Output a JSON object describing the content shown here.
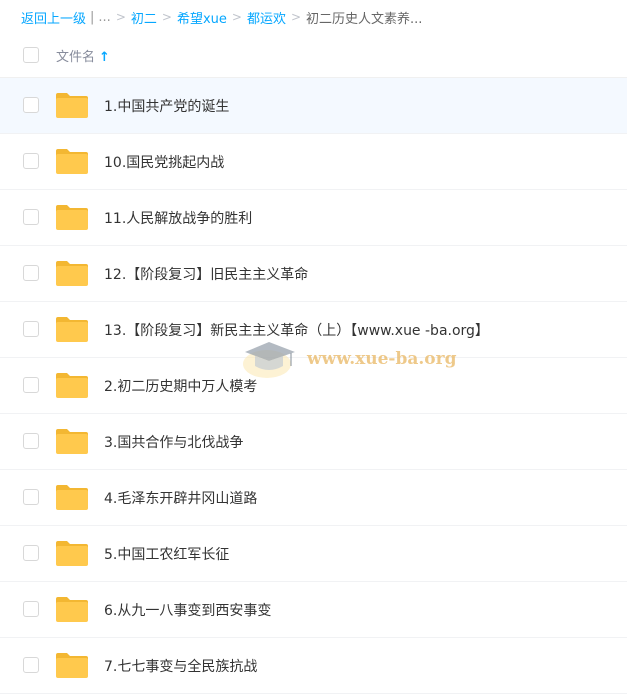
{
  "breadcrumb": {
    "back_label": "返回上一级",
    "divider": "|",
    "ellipsis": "...",
    "items": [
      "初二",
      "希望xue",
      "都运欢"
    ],
    "current": "初二历史人文素养..."
  },
  "list_header": {
    "column_label": "文件名",
    "sort_arrow": "↑"
  },
  "files": [
    {
      "name": "1.中国共产党的诞生",
      "icon": "folder-icon"
    },
    {
      "name": "10.国民党挑起内战",
      "icon": "folder-icon"
    },
    {
      "name": "11.人民解放战争的胜利",
      "icon": "folder-icon"
    },
    {
      "name": "12.【阶段复习】旧民主主义革命",
      "icon": "folder-icon"
    },
    {
      "name": "13.【阶段复习】新民主主义革命（上）【www.xue -ba.org】",
      "icon": "folder-icon"
    },
    {
      "name": "2.初二历史期中万人模考",
      "icon": "folder-icon"
    },
    {
      "name": "3.国共合作与北伐战争",
      "icon": "folder-icon"
    },
    {
      "name": "4.毛泽东开辟井冈山道路",
      "icon": "folder-icon"
    },
    {
      "name": "5.中国工农红军长征",
      "icon": "folder-icon"
    },
    {
      "name": "6.从九一八事变到西安事变",
      "icon": "folder-icon"
    },
    {
      "name": "7.七七事变与全民族抗战",
      "icon": "folder-icon"
    }
  ],
  "watermark": {
    "text": "www.xue-ba.org"
  },
  "colors": {
    "link": "#06a7ff",
    "folder": "#ffc94d",
    "hover_row": "#f4f9ff"
  }
}
